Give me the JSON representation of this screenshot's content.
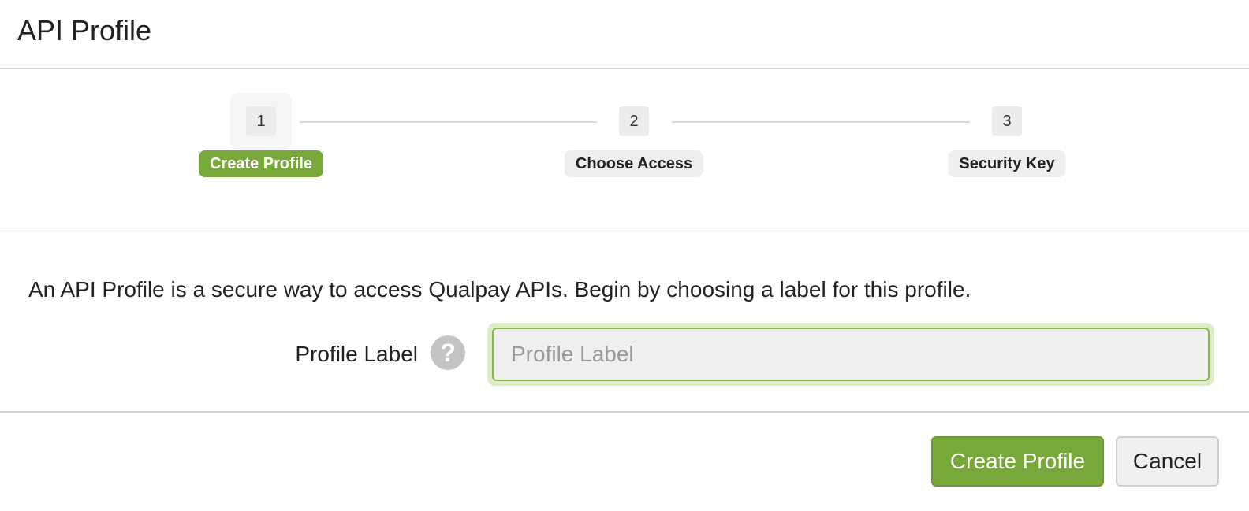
{
  "header": {
    "title": "API Profile"
  },
  "stepper": {
    "steps": [
      {
        "number": "1",
        "label": "Create Profile",
        "active": true
      },
      {
        "number": "2",
        "label": "Choose Access",
        "active": false
      },
      {
        "number": "3",
        "label": "Security Key",
        "active": false
      }
    ]
  },
  "body": {
    "intro": "An API Profile is a secure way to access Qualpay APIs. Begin by choosing a label for this profile.",
    "profile_label": {
      "label": "Profile Label",
      "placeholder": "Profile Label",
      "value": "",
      "help_icon": "question-circle-icon"
    }
  },
  "footer": {
    "create_label": "Create Profile",
    "cancel_label": "Cancel"
  },
  "colors": {
    "accent": "#78a73a",
    "focus_ring": "#dcebc8"
  }
}
